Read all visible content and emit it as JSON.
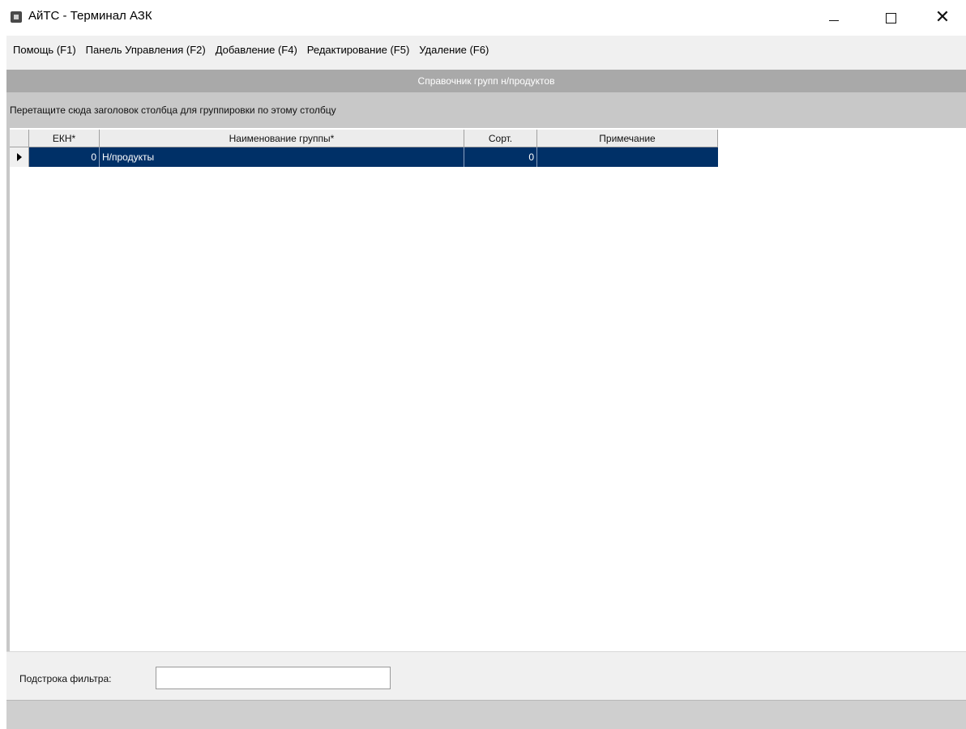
{
  "window": {
    "title": "АйТС - Терминал АЗК",
    "icon": "app-icon"
  },
  "menu": {
    "items": [
      {
        "label": "Помощь (F1)"
      },
      {
        "label": "Панель Управления (F2)"
      },
      {
        "label": "Добавление (F4)"
      },
      {
        "label": "Редактирование (F5)"
      },
      {
        "label": "Удаление (F6)"
      }
    ]
  },
  "caption": "Справочник групп н/продуктов",
  "grid": {
    "group_hint": "Перетащите сюда заголовок столбца для группировки по этому столбцу",
    "columns": [
      "ЕКН*",
      "Наименование группы*",
      "Сорт.",
      "Примечание"
    ],
    "rows": [
      {
        "ekn": "0",
        "name": "Н/продукты",
        "sort": "0",
        "note": ""
      }
    ],
    "selection_color": "#003067"
  },
  "filter": {
    "label": "Подстрока фильтра:",
    "value": ""
  }
}
